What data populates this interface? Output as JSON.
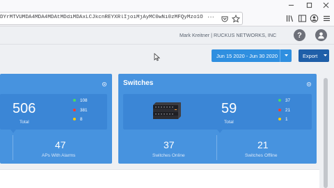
{
  "browser": {
    "url": "DYrMTVUMDA4MDA4MDAtMDdiMDAxLCJkcnREYXRlIjoiMjAyMC0wNi0zMFQyMzo1OTo1O"
  },
  "header": {
    "user": "Mark Kreitner | RUCKUS NETWORKS, INC",
    "help_glyph": "?"
  },
  "toolbar": {
    "date_range": "Jun 15 2020 - Jun 30 2020",
    "export": "Export"
  },
  "aps_card": {
    "total": "506",
    "total_label": "Total",
    "statuses": [
      {
        "value": "108",
        "color": "#4cd964"
      },
      {
        "value": "381",
        "color": "#ff3b30"
      },
      {
        "value": "8",
        "color": "#ffcc00"
      }
    ],
    "sub_value": "47",
    "sub_label": "APs With Alarms"
  },
  "switches_card": {
    "title": "Switches",
    "total": "59",
    "total_label": "Total",
    "statuses": [
      {
        "value": "37",
        "color": "#4cd964"
      },
      {
        "value": "21",
        "color": "#ff3b30"
      },
      {
        "value": "1",
        "color": "#ffcc00"
      }
    ],
    "online_value": "37",
    "online_label": "Switches Online",
    "offline_value": "21",
    "offline_label": "Switches Offline"
  },
  "icons": {
    "library": "library-icon",
    "reader": "reader-view-icon",
    "account": "account-icon",
    "menu": "hamburger-menu-icon"
  }
}
